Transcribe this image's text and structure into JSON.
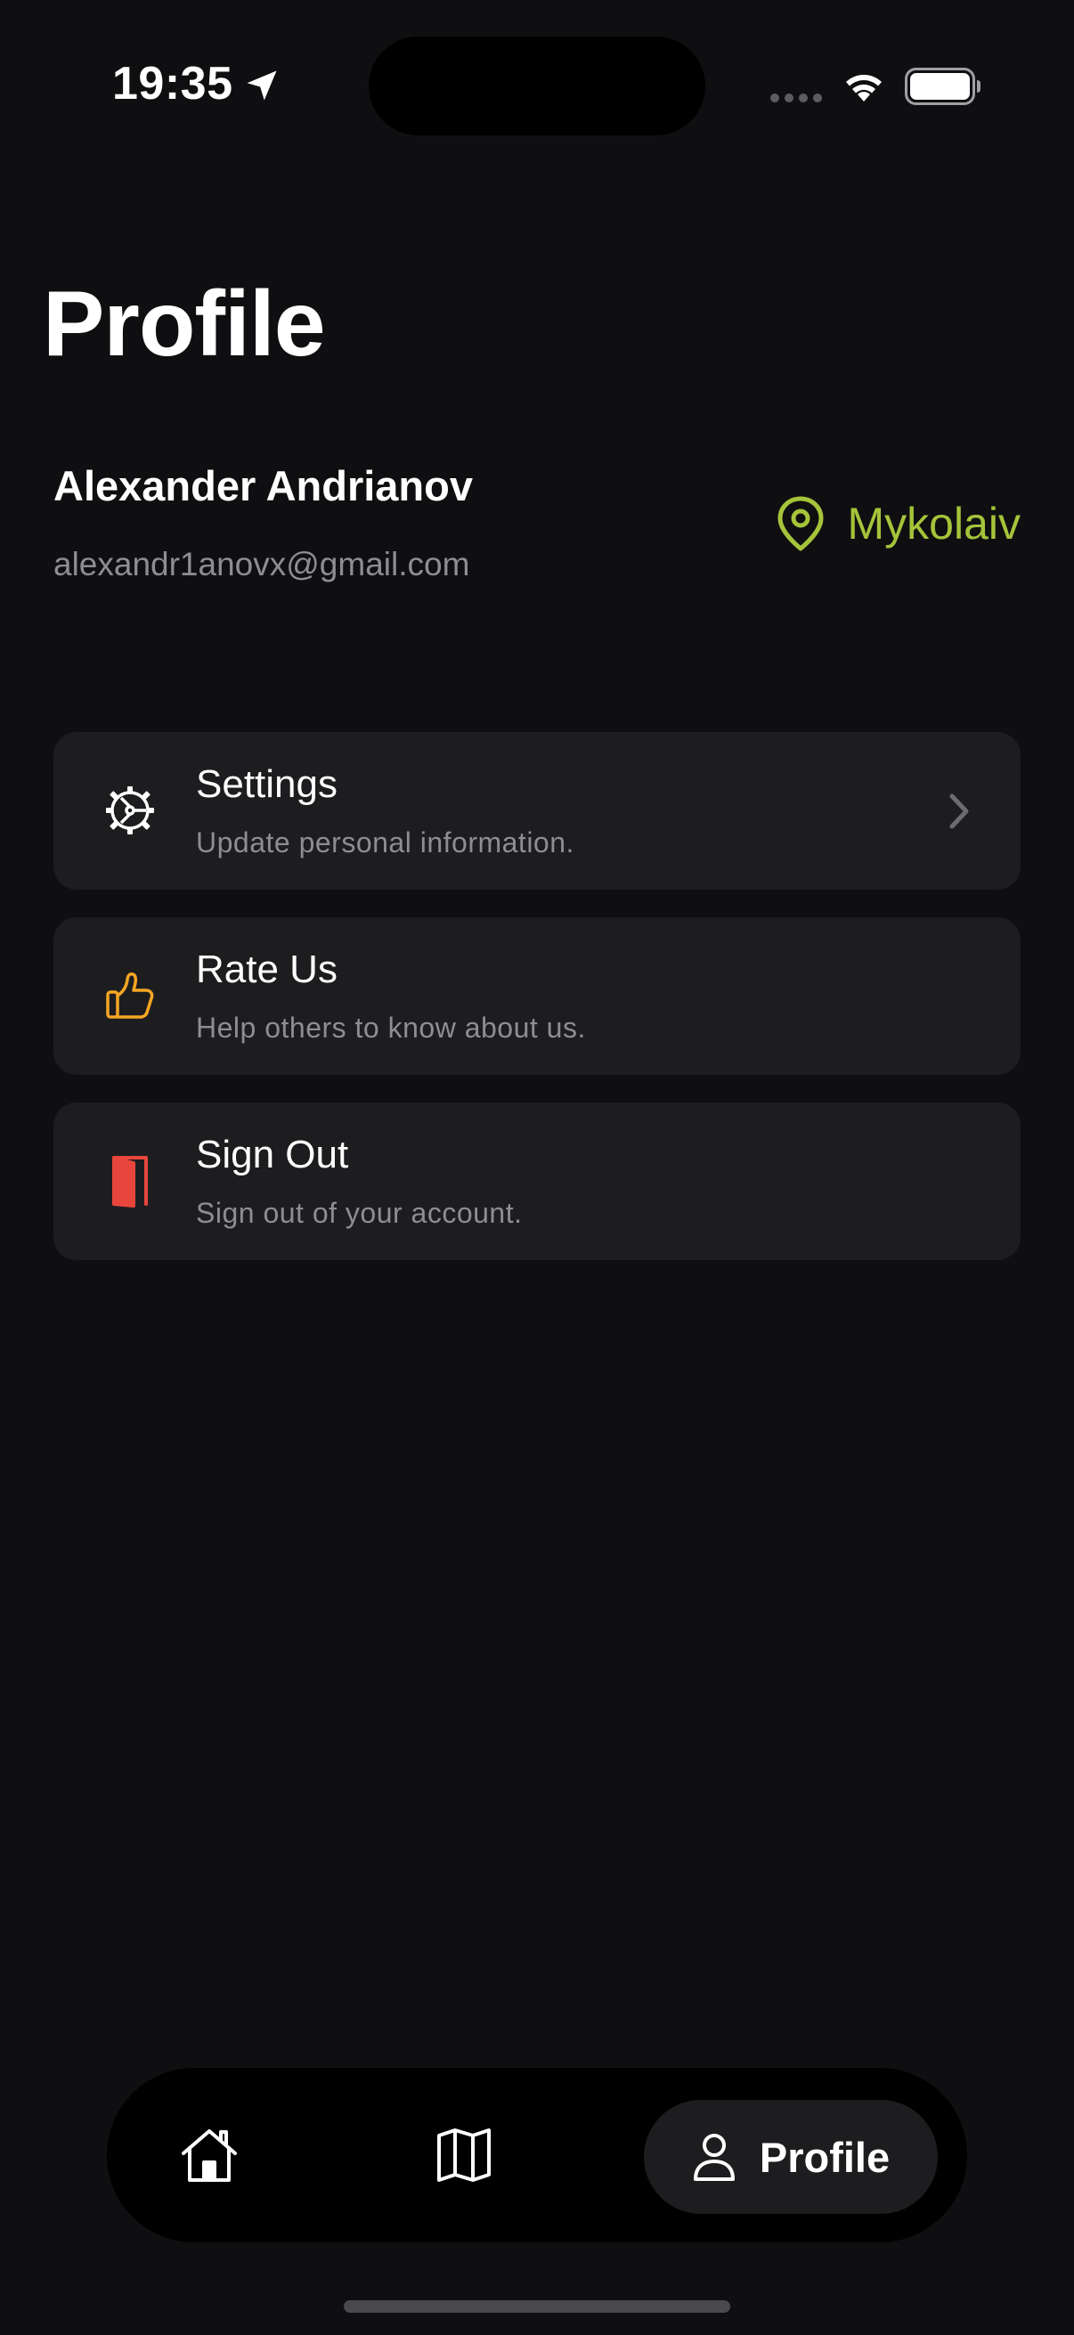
{
  "status_bar": {
    "time": "19:35"
  },
  "header": {
    "title": "Profile"
  },
  "user": {
    "name": "Alexander Andrianov",
    "email": "alexandr1anovx@gmail.com",
    "location": "Mykolaiv"
  },
  "menu": [
    {
      "title": "Settings",
      "subtitle": "Update personal information.",
      "icon": "gear-icon",
      "icon_color": "#ffffff"
    },
    {
      "title": "Rate Us",
      "subtitle": "Help others to know about us.",
      "icon": "thumbs-up-icon",
      "icon_color": "#f5a623"
    },
    {
      "title": "Sign Out",
      "subtitle": "Sign out of your account.",
      "icon": "door-icon",
      "icon_color": "#e8453c"
    }
  ],
  "tab_bar": {
    "items": [
      {
        "icon": "house-icon",
        "label": ""
      },
      {
        "icon": "map-icon",
        "label": ""
      },
      {
        "icon": "person-icon",
        "label": "Profile",
        "selected": true
      }
    ]
  },
  "colors": {
    "background": "#0f0f11",
    "card": "#1d1d1f",
    "accent_location": "#a5c43a",
    "secondary_text": "#8d8d93"
  }
}
